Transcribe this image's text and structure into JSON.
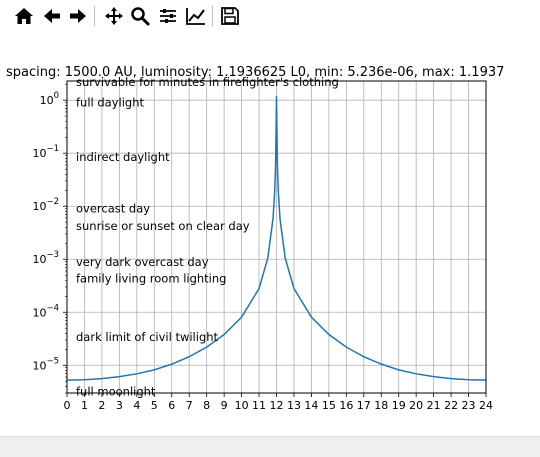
{
  "toolbar": {
    "buttons": [
      {
        "name": "home-icon"
      },
      {
        "name": "back-arrow-icon"
      },
      {
        "name": "forward-arrow-icon"
      },
      {
        "name": "pan-move-icon"
      },
      {
        "name": "zoom-icon"
      },
      {
        "name": "configure-subplots-icon"
      },
      {
        "name": "edit-axis-icon"
      },
      {
        "name": "save-icon"
      }
    ]
  },
  "chart_data": {
    "type": "line",
    "title": "spacing: 1500.0 AU, luminosity: 1.1936625 L0, min: 5.236e-06, max: 1.1937",
    "xlabel": "",
    "ylabel": "",
    "xlim": [
      0,
      24
    ],
    "ylim": [
      3e-06,
      2.3
    ],
    "yscale": "log",
    "grid": true,
    "line_color": "#1f77b4",
    "x_ticks": [
      "0",
      "1",
      "2",
      "3",
      "4",
      "5",
      "6",
      "7",
      "8",
      "9",
      "10",
      "11",
      "12",
      "13",
      "14",
      "15",
      "16",
      "17",
      "18",
      "19",
      "20",
      "21",
      "22",
      "23",
      "24"
    ],
    "y_ticks": [
      {
        "value": 1e-05,
        "base": "10",
        "exp": "−5"
      },
      {
        "value": 0.0001,
        "base": "10",
        "exp": "−4"
      },
      {
        "value": 0.001,
        "base": "10",
        "exp": "−3"
      },
      {
        "value": 0.01,
        "base": "10",
        "exp": "−2"
      },
      {
        "value": 0.1,
        "base": "10",
        "exp": "−1"
      },
      {
        "value": 1,
        "base": "10",
        "exp": "0"
      }
    ],
    "series": [
      {
        "x": [
          0,
          1,
          2,
          3,
          4,
          5,
          6,
          7,
          8,
          9,
          10,
          11,
          11.5,
          11.8,
          11.9,
          11.95,
          12,
          12.05,
          12.1,
          12.2,
          12.5,
          13,
          14,
          15,
          16,
          17,
          18,
          19,
          20,
          21,
          22,
          23,
          24
        ],
        "y": [
          5.24e-06,
          5.33e-06,
          5.6e-06,
          6.1e-06,
          6.9e-06,
          8.2e-06,
          1.05e-05,
          1.45e-05,
          2.2e-05,
          3.8e-05,
          8.1e-05,
          0.00028,
          0.00105,
          0.0058,
          0.02,
          0.065,
          1.1937,
          0.065,
          0.02,
          0.0058,
          0.00105,
          0.00028,
          8.1e-05,
          3.8e-05,
          2.2e-05,
          1.45e-05,
          1.05e-05,
          8.2e-06,
          6.9e-06,
          6.1e-06,
          5.6e-06,
          5.33e-06,
          5.24e-06
        ]
      }
    ],
    "annotations": [
      {
        "text": "survivable for minutes in firefighter's clothing",
        "y": 2.2
      },
      {
        "text": "full daylight",
        "y": 0.9
      },
      {
        "text": "indirect daylight",
        "y": 0.085
      },
      {
        "text": "overcast day",
        "y": 0.009
      },
      {
        "text": "sunrise or sunset on clear day",
        "y": 0.0042
      },
      {
        "text": "very dark overcast day",
        "y": 0.00088
      },
      {
        "text": "family living room lighting",
        "y": 0.00043
      },
      {
        "text": "dark limit of civil twilight",
        "y": 3.4e-05
      },
      {
        "text": "full moonlight",
        "y": 3.2e-06
      }
    ]
  }
}
